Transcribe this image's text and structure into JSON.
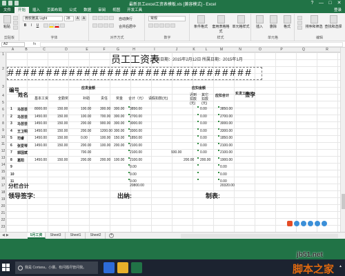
{
  "window": {
    "title": "最新员工excel工资表模板.xls [兼容模式] - Excel",
    "controls": [
      "?",
      "—",
      "□",
      "✕"
    ]
  },
  "ribbon_tabs": [
    "文件",
    "开始",
    "插入",
    "页面布局",
    "公式",
    "数据",
    "审阅",
    "视图",
    "开发工具"
  ],
  "login": "登录",
  "ribbon": {
    "paste_label": "粘贴",
    "clipboard_label": "剪贴板",
    "font_name": "微软雅黑 Light",
    "font_size": "28",
    "font_group_label": "字体",
    "align_group_label": "对齐方式",
    "wrap_label": "自动换行",
    "merge_label": "合并后居中",
    "number_format": "常规",
    "number_group_label": "数字",
    "cond_format_label": "条件格式",
    "table_format_label": "套用表格格式",
    "cell_style_label": "单元格样式",
    "styles_group_label": "样式",
    "insert_label": "插入",
    "delete_label": "删除",
    "format_label": "格式",
    "cells_group_label": "单元格",
    "sort_label": "排序和筛选",
    "find_label": "查找和选择",
    "edit_group_label": "编辑"
  },
  "formula_bar": {
    "name_box": "A2",
    "fx": "fx",
    "value": ""
  },
  "columns": [
    "A",
    "B",
    "C",
    "D",
    "E",
    "F",
    "G",
    "H",
    "I",
    "J",
    "K",
    "L",
    "M",
    "N",
    "O",
    "P",
    "Q",
    "R"
  ],
  "rows": [
    "1",
    "2",
    "3",
    "4",
    "5",
    "6",
    "7",
    "8",
    "9",
    "10",
    "11",
    "12",
    "13",
    "14",
    "15",
    "16",
    "17",
    "18",
    "19",
    "20",
    "21",
    "22",
    "23",
    "24",
    "25"
  ],
  "sheet": {
    "title": "员工工资表",
    "date_line": "发放日期：2015年2月12日  所属日期：2015年1月",
    "hash_row": "################################",
    "header_no": "编号",
    "header_name": "姓名",
    "header_shouldpay": "应发金额",
    "header_deduct": "应扣金额",
    "header_basic": "基本工资",
    "header_allowance": "全勤奖",
    "header_subsidy": "补助",
    "header_overtime": "责任",
    "header_bonus": "奖金",
    "header_total": "合计（元）",
    "header_leave": "请假扣款(元)",
    "header_late": "迟到扣款(元)",
    "header_other": "其它扣款(元)",
    "header_deduct_total": "应扣合计",
    "header_actual": "实发工资(元)",
    "header_sign": "签字",
    "employees": [
      {
        "no": "1",
        "name": "马芸芸",
        "basic": "8000.00",
        "allowance": "150.00",
        "subsidy": "100.00",
        "duty": "300.00",
        "bonus": "300.00",
        "total": "3850.00",
        "leave": "",
        "late": "",
        "deduct": "0.00",
        "actual": "3850.00"
      },
      {
        "no": "2",
        "name": "马芸芸",
        "basic": "1450.00",
        "allowance": "150.00",
        "subsidy": "100.00",
        "duty": "700.00",
        "bonus": "300.00",
        "total": "2700.00",
        "leave": "",
        "late": "",
        "deduct": "0.00",
        "actual": "2700.00"
      },
      {
        "no": "3",
        "name": "马芸芸",
        "basic": "1450.00",
        "allowance": "150.00",
        "subsidy": "200.00",
        "duty": "900.00",
        "bonus": "300.00",
        "total": "3000.00",
        "leave": "",
        "late": "",
        "deduct": "0.00",
        "actual": "3000.00"
      },
      {
        "no": "4",
        "name": "王卫明",
        "basic": "1450.00",
        "allowance": "150.00",
        "subsidy": "200.00",
        "duty": "1200.00",
        "bonus": "300.00",
        "total": "3300.00",
        "leave": "",
        "late": "",
        "deduct": "0.00",
        "actual": "3300.00"
      },
      {
        "no": "5",
        "name": "司睿",
        "basic": "1450.00",
        "allowance": "150.00",
        "subsidy": "0.00",
        "duty": "100.00",
        "bonus": "150.00",
        "total": "1850.00",
        "leave": "",
        "late": "",
        "deduct": "0.00",
        "actual": "1850.00"
      },
      {
        "no": "6",
        "name": "张爱琴",
        "basic": "1450.00",
        "allowance": "150.00",
        "subsidy": "200.00",
        "duty": "100.00",
        "bonus": "200.00",
        "total": "2100.00",
        "leave": "",
        "late": "",
        "deduct": "0.00",
        "actual": "2100.00"
      },
      {
        "no": "7",
        "name": "郭国斌",
        "basic": "",
        "allowance": "",
        "subsidy": "700.00",
        "duty": "",
        "bonus": "",
        "total": "2100.00",
        "leave": "930.00",
        "late": "",
        "deduct": "0.00",
        "actual": "2100.00"
      },
      {
        "no": "8",
        "name": "葛阳",
        "basic": "1450.00",
        "allowance": "150.00",
        "subsidy": "200.00",
        "duty": "200.00",
        "bonus": "100.00",
        "total": "2100.00",
        "leave": "",
        "late": "200.00",
        "deduct": "200.00",
        "actual": "1900.00"
      },
      {
        "no": "9",
        "name": "",
        "basic": "",
        "allowance": "",
        "subsidy": "",
        "duty": "",
        "bonus": "",
        "total": "0.00",
        "leave": "",
        "late": "",
        "deduct": "",
        "actual": "0.00"
      },
      {
        "no": "10",
        "name": "",
        "basic": "",
        "allowance": "",
        "subsidy": "",
        "duty": "",
        "bonus": "",
        "total": "0.00",
        "leave": "",
        "late": "",
        "deduct": "",
        "actual": "0.00"
      },
      {
        "no": "11",
        "name": "",
        "basic": "",
        "allowance": "",
        "subsidy": "",
        "duty": "",
        "bonus": "",
        "total": "0.00",
        "leave": "",
        "late": "",
        "deduct": "",
        "actual": "0.00"
      }
    ],
    "subtotal_label": "分栏合计",
    "subtotal_total": "20800.00",
    "subtotal_actual": "20320.00",
    "leader_sign": "领导签字:",
    "cashier": "出纳:",
    "maker": "制表:"
  },
  "sheet_tabs": [
    "5月工资",
    "Sheet3",
    "Sheet1",
    "Sheet2"
  ],
  "taskbar": {
    "search_placeholder": "我是 Cortana，小娜。有问题尽管问我。"
  },
  "watermark": {
    "site": "jb51.net",
    "cn": "脚本之家"
  },
  "colors": {
    "excel_green": "#217346",
    "taskbar": "#1c2330",
    "watermark_orange": "#e0690f"
  }
}
